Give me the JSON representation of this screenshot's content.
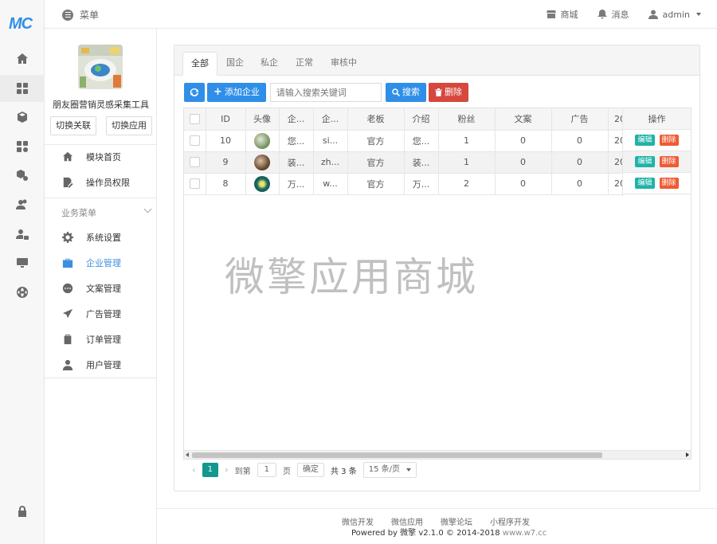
{
  "brand": {
    "logo_text": "MC",
    "accent": "#2f8fe8"
  },
  "rail": {
    "items": [
      {
        "icon": "home-icon"
      },
      {
        "icon": "grid-icon",
        "active": true
      },
      {
        "icon": "cube-icon"
      },
      {
        "icon": "apps-settings-icon"
      },
      {
        "icon": "box-gear-icon"
      },
      {
        "icon": "users-icon"
      },
      {
        "icon": "user-lock-icon"
      },
      {
        "icon": "monitor-icon"
      },
      {
        "icon": "globe-icon"
      }
    ],
    "bottom_icon": "lock-icon"
  },
  "topbar": {
    "menu_label": "菜单",
    "shop_label": "商城",
    "message_label": "消息",
    "user_label": "admin"
  },
  "sidebar": {
    "app_name": "朋友圈营销灵感采集工具",
    "switch_link_btn": "切换关联",
    "switch_app_btn": "切换应用",
    "top_items": [
      {
        "label": "模块首页",
        "icon": "home-icon"
      },
      {
        "label": "操作员权限",
        "icon": "edit-doc-icon"
      }
    ],
    "group_title": "业务菜单",
    "items": [
      {
        "label": "系统设置",
        "icon": "gear-icon"
      },
      {
        "label": "企业管理",
        "icon": "briefcase-icon",
        "active": true
      },
      {
        "label": "文案管理",
        "icon": "chat-dots-icon"
      },
      {
        "label": "广告管理",
        "icon": "send-icon"
      },
      {
        "label": "订单管理",
        "icon": "clipboard-icon"
      },
      {
        "label": "用户管理",
        "icon": "user-icon"
      }
    ]
  },
  "tabs": [
    "全部",
    "国企",
    "私企",
    "正常",
    "审核中"
  ],
  "toolbar": {
    "add_label": "添加企业",
    "search_placeholder": "请输入搜索关键词",
    "search_label": "搜索",
    "delete_label": "删除"
  },
  "table": {
    "columns": [
      "ID",
      "头像",
      "企...",
      "企...",
      "老板",
      "介绍",
      "粉丝",
      "文案",
      "广告",
      "20"
    ],
    "ops_header": "操作",
    "rows": [
      {
        "id": "10",
        "avatar_color": "#7d9a6a",
        "c1": "您...",
        "c2": "si...",
        "boss": "官方",
        "intro": "您...",
        "fans": "1",
        "copy": "0",
        "ads": "0",
        "date": "20"
      },
      {
        "id": "9",
        "avatar_color": "#6b4a32",
        "c1": "装...",
        "c2": "zh...",
        "boss": "官方",
        "intro": "装...",
        "fans": "1",
        "copy": "0",
        "ads": "0",
        "date": "20"
      },
      {
        "id": "8",
        "avatar_color": "#1b6f5c",
        "c1": "万...",
        "c2": "w...",
        "boss": "官方",
        "intro": "万...",
        "fans": "2",
        "copy": "0",
        "ads": "0",
        "date": "20"
      }
    ],
    "edit_label": "编辑",
    "delete_label": "删除"
  },
  "watermark": "微擎应用商城",
  "pager": {
    "current": "1",
    "goto_label": "到第",
    "goto_value": "1",
    "page_unit": "页",
    "confirm": "确定",
    "total": "共 3 条",
    "page_size": "15 条/页"
  },
  "footer": {
    "links": [
      "微信开发",
      "微信应用",
      "微擎论坛",
      "小程序开发"
    ],
    "powered_prefix": "Powered by",
    "powered_brand": "微擎",
    "version": "v2.1.0 © 2014-2018",
    "domain": "www.w7.cc"
  }
}
